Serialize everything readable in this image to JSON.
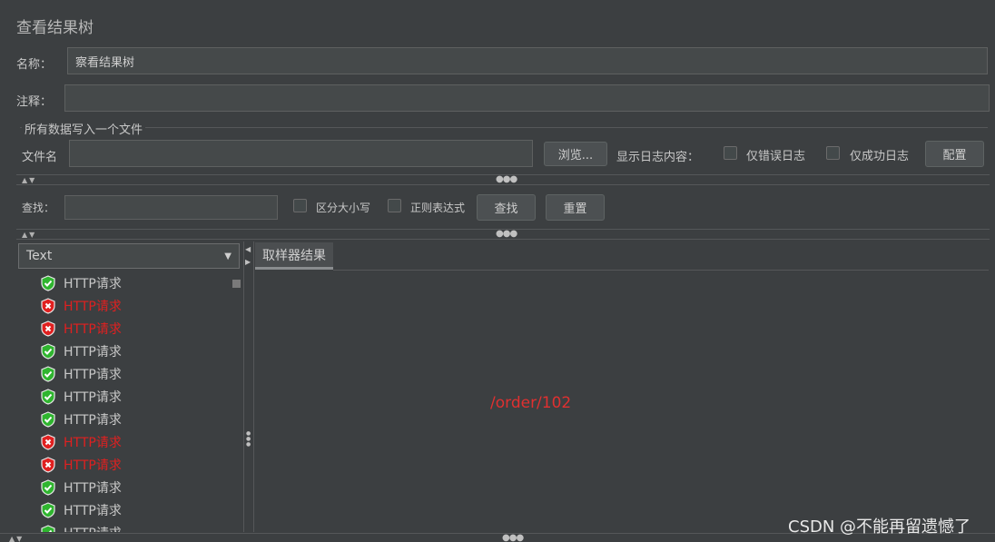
{
  "panel_title": "查看结果树",
  "name_label": "名称：",
  "name_value": "察看结果树",
  "comment_label": "注释：",
  "comment_value": "",
  "file_group_title": "所有数据写入一个文件",
  "filename_label": "文件名",
  "filename_value": "",
  "browse_label": "浏览...",
  "log_content_label": "显示日志内容：",
  "errors_only_label": "仅错误日志",
  "success_only_label": "仅成功日志",
  "config_label": "配置",
  "search_label": "查找：",
  "search_value": "",
  "case_sensitive_label": "区分大小写",
  "regex_label": "正则表达式",
  "find_label": "查找",
  "reset_label": "重置",
  "renderer_selected": "Text",
  "tab_sampler_result": "取样器结果",
  "detail_text": "/order/102",
  "watermark": "CSDN @不能再留遗憾了",
  "colors": {
    "success": "#2fb52f",
    "error": "#e02020",
    "background": "#3c3f41"
  },
  "tree_items": [
    {
      "label": "HTTP请求",
      "status": "success"
    },
    {
      "label": "HTTP请求",
      "status": "error"
    },
    {
      "label": "HTTP请求",
      "status": "error"
    },
    {
      "label": "HTTP请求",
      "status": "success"
    },
    {
      "label": "HTTP请求",
      "status": "success"
    },
    {
      "label": "HTTP请求",
      "status": "success"
    },
    {
      "label": "HTTP请求",
      "status": "success"
    },
    {
      "label": "HTTP请求",
      "status": "error"
    },
    {
      "label": "HTTP请求",
      "status": "error"
    },
    {
      "label": "HTTP请求",
      "status": "success"
    },
    {
      "label": "HTTP请求",
      "status": "success"
    },
    {
      "label": "HTTP请求",
      "status": "success"
    }
  ]
}
